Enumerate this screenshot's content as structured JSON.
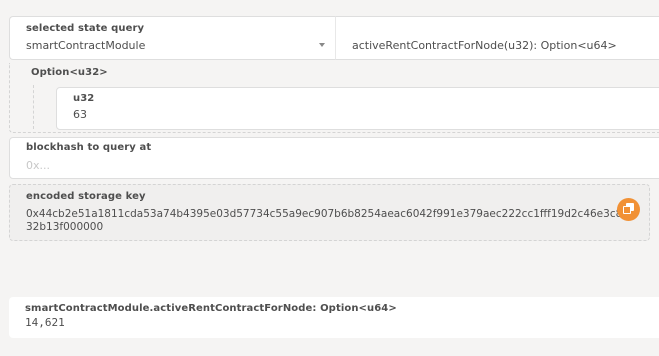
{
  "query": {
    "selected_state_label": "selected state query",
    "module": "smartContractModule",
    "method": "activeRentContractForNode(u32): Option<u64>"
  },
  "param": {
    "option_label": "Option<u32>",
    "u32_label": "u32",
    "u32_value": "63"
  },
  "blockhash": {
    "label": "blockhash to query at",
    "placeholder": "0x..."
  },
  "encoded": {
    "label": "encoded storage key",
    "value": "0x44cb2e51a1811cda53a74b4395e03d57734c55a9ec907b6b8254aeac6042f991e379aec222cc1fff19d2c46e3c832b13f000000"
  },
  "result": {
    "label": "smartContractModule.activeRentContractForNode: Option<u64>",
    "value": "14,621"
  },
  "icons": {
    "dropdown": "chevron-down-icon",
    "copy": "copy-icon"
  },
  "colors": {
    "accent": "#f19135",
    "background": "#f5f4f3"
  }
}
